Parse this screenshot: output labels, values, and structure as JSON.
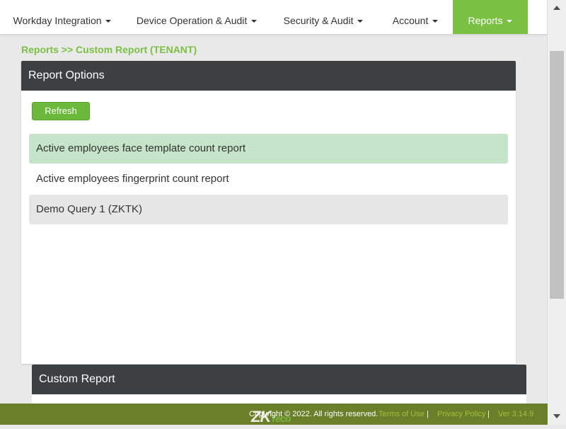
{
  "nav": {
    "items": [
      {
        "label": "Workday Integration"
      },
      {
        "label": "Device Operation & Audit"
      },
      {
        "label": "Security & Audit"
      },
      {
        "label": "Account"
      },
      {
        "label": "Reports"
      }
    ]
  },
  "breadcrumb": "Reports >> Custom Report (TENANT)",
  "report_options": {
    "title": "Report Options",
    "refresh_label": "Refresh",
    "reports": [
      {
        "label": "Active employees face template count report"
      },
      {
        "label": "Active employees fingerprint count report"
      },
      {
        "label": "Demo Query 1 (ZKTK)"
      }
    ]
  },
  "custom_report": {
    "title": "Custom Report"
  },
  "footer": {
    "copyright": "Copyright © 2022. All rights reserved.",
    "terms": "Terms of Use",
    "privacy": "Privacy Policy",
    "version": "Ver 3.14.9",
    "separator": "|",
    "logo_zk": "ZK",
    "logo_tec": "Teco"
  },
  "colors": {
    "accent": "#7ac143",
    "header_dark": "#3d4043",
    "footer": "#6b7f2a"
  }
}
